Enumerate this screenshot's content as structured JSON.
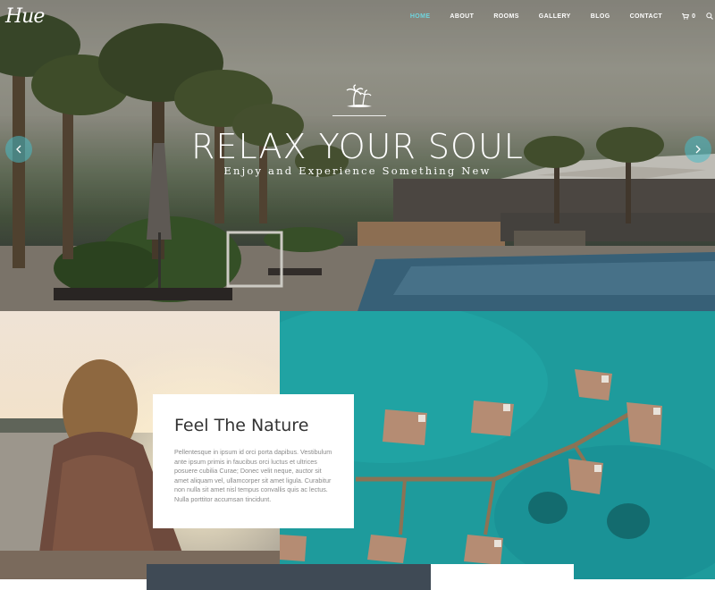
{
  "brand": {
    "logo_text": "Hue"
  },
  "nav": {
    "items": [
      {
        "label": "HOME",
        "active": true
      },
      {
        "label": "ABOUT",
        "active": false
      },
      {
        "label": "ROOMS",
        "active": false
      },
      {
        "label": "GALLERY",
        "active": false
      },
      {
        "label": "BLOG",
        "active": false
      },
      {
        "label": "CONTACT",
        "active": false
      }
    ],
    "cart_count": "0",
    "active_color": "#6fd4de"
  },
  "hero": {
    "title": "RELAX YOUR SOUL",
    "subtitle": "Enjoy and Experience Something New",
    "emblem": "palm-island-icon",
    "prev_icon": "chevron-left-icon",
    "next_icon": "chevron-right-icon"
  },
  "feature": {
    "title": "Feel The Nature",
    "body": "Pellentesque in ipsum id orci porta dapibus. Vestibulum ante ipsum primis in faucibus orci luctus et ultrices posuere cubilia Curae; Donec velit neque, auctor sit amet aliquam vel, ullamcorper sit amet ligula. Curabitur non nulla sit amet nisl tempus convallis quis ac lectus. Nulla porttitor accumsan tincidunt."
  },
  "colors": {
    "accent": "#48b9c4",
    "lagoon": "#1f9a9e"
  }
}
